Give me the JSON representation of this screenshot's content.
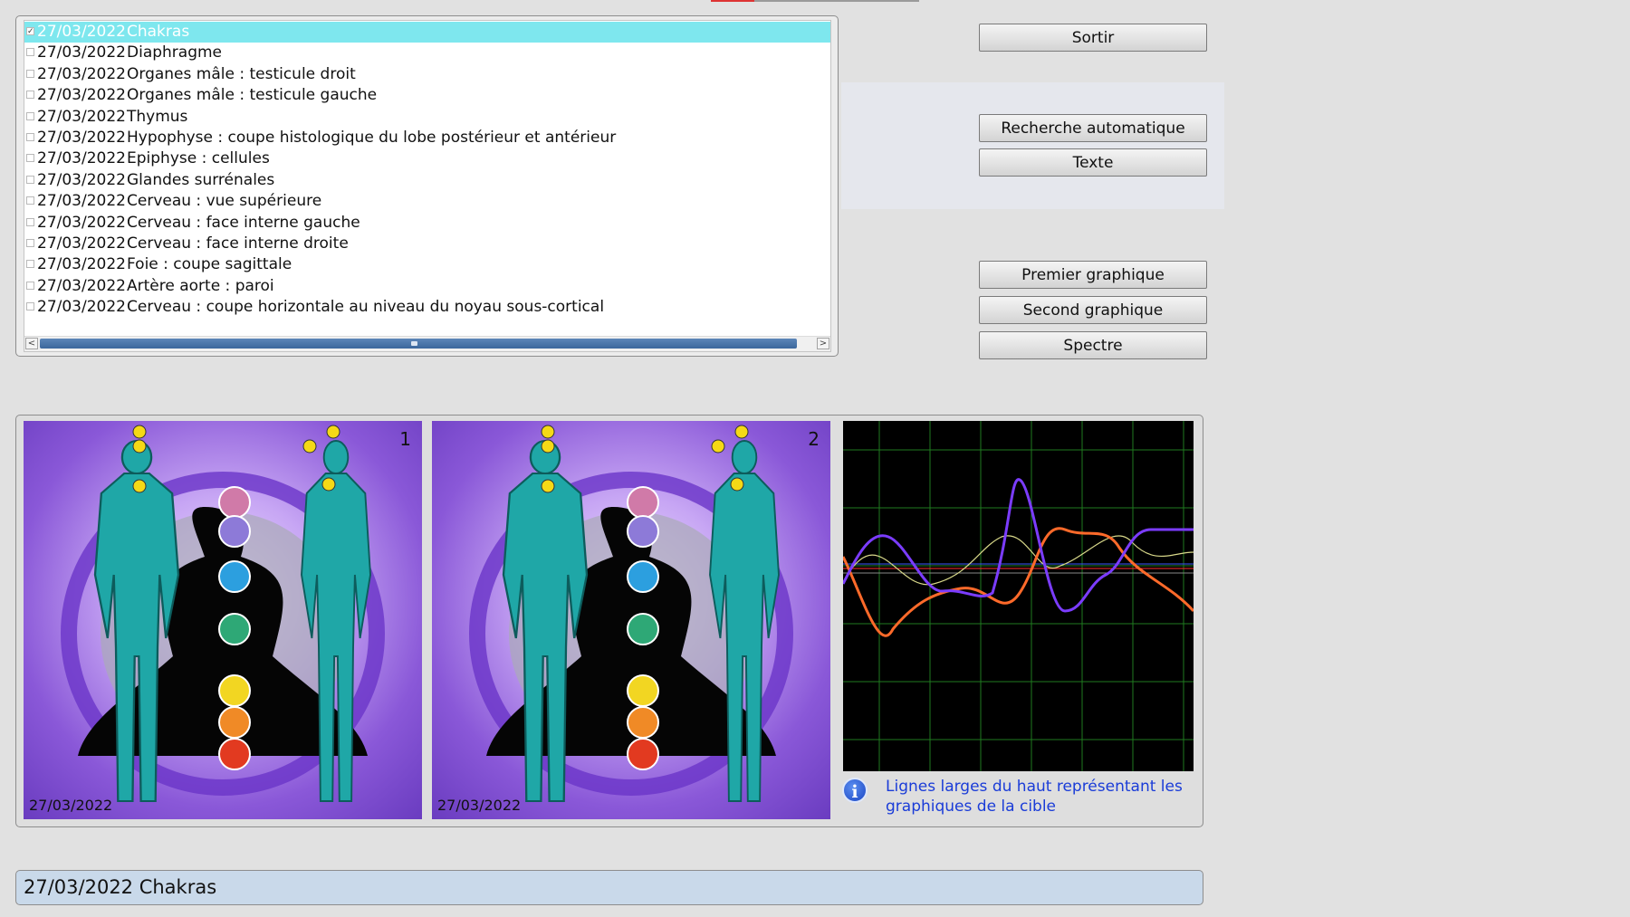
{
  "list": {
    "rows": [
      {
        "date": "27/03/2022",
        "label": "Chakras",
        "checked": true,
        "selected": true
      },
      {
        "date": "27/03/2022",
        "label": "Diaphragme"
      },
      {
        "date": "27/03/2022",
        "label": "Organes mâle : testicule droit"
      },
      {
        "date": "27/03/2022",
        "label": "Organes mâle : testicule gauche"
      },
      {
        "date": "27/03/2022",
        "label": "Thymus"
      },
      {
        "date": "27/03/2022",
        "label": "Hypophyse : coupe histologique du lobe postérieur et antérieur"
      },
      {
        "date": "27/03/2022",
        "label": "Epiphyse : cellules"
      },
      {
        "date": "27/03/2022",
        "label": "Glandes surrénales"
      },
      {
        "date": "27/03/2022",
        "label": "Cerveau : vue supérieure"
      },
      {
        "date": "27/03/2022",
        "label": "Cerveau : face interne gauche"
      },
      {
        "date": "27/03/2022",
        "label": "Cerveau : face interne  droite"
      },
      {
        "date": "27/03/2022",
        "label": "Foie : coupe sagittale"
      },
      {
        "date": "27/03/2022",
        "label": "Artère aorte : paroi"
      },
      {
        "date": "27/03/2022",
        "label": "Cerveau : coupe horizontale au niveau du noyau sous-cortical"
      }
    ],
    "scroll_left_glyph": "<",
    "scroll_right_glyph": ">"
  },
  "buttons": {
    "sortir": "Sortir",
    "recherche": "Recherche automatique",
    "texte": "Texte",
    "premier": "Premier graphique",
    "second": "Second graphique",
    "spectre": "Spectre"
  },
  "images": [
    {
      "number": "1",
      "date": "27/03/2022"
    },
    {
      "number": "2",
      "date": "27/03/2022"
    }
  ],
  "info": {
    "icon": "info-icon",
    "glyph": "i",
    "text": "Lignes larges du haut représentant les graphiques de la cible"
  },
  "status": {
    "text": "27/03/2022 Chakras"
  },
  "colors": {
    "selection": "#7ee7ee",
    "info_text": "#1a3cd8",
    "status_bg": "#c9d9ea",
    "curve_violet": "#7b3cff",
    "curve_orange": "#ff6a2a",
    "curve_yellow": "#d9d98a"
  }
}
